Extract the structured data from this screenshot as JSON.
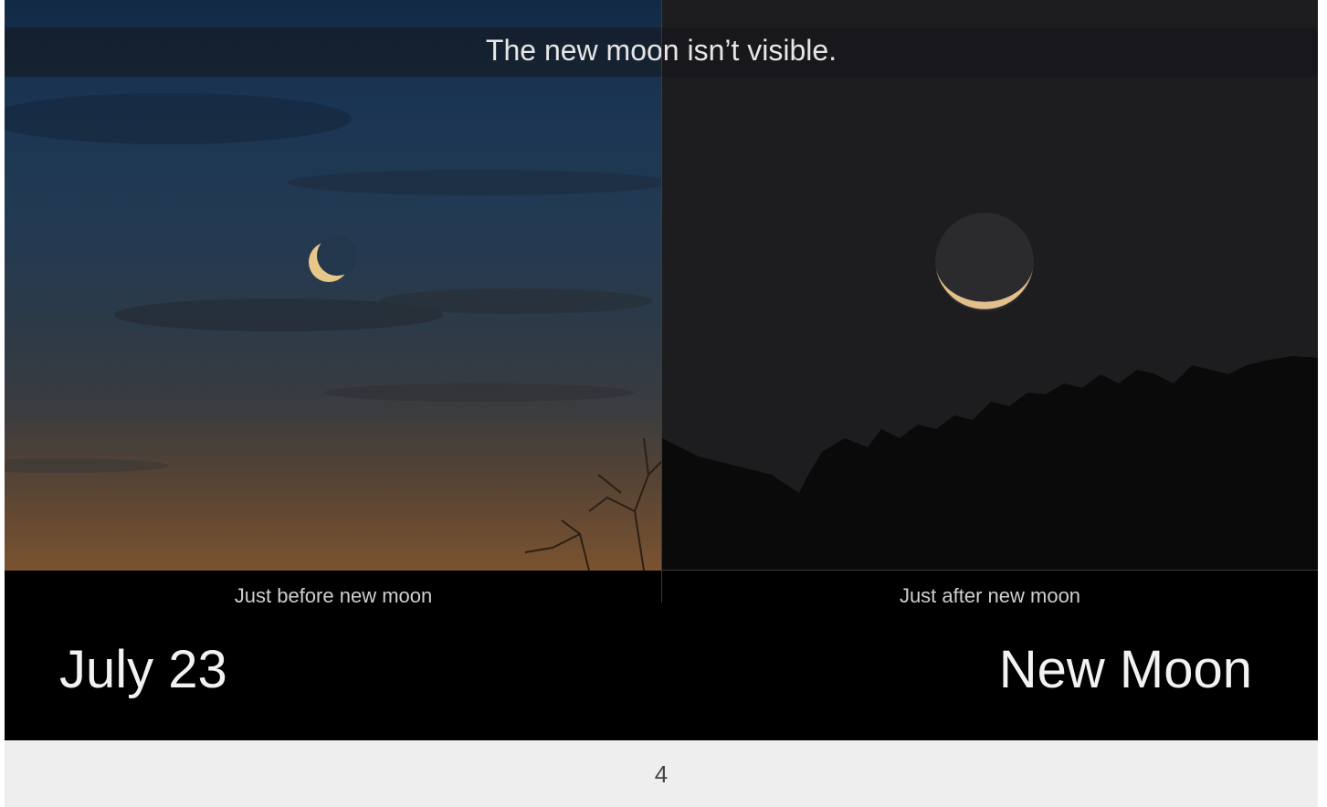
{
  "banner": {
    "text": "The new moon isn’t visible."
  },
  "panels": [
    {
      "caption": "Just before new moon"
    },
    {
      "caption": "Just after new moon"
    }
  ],
  "labels": {
    "date": "July 23",
    "phase": "New Moon"
  },
  "footer": {
    "page_number": "4"
  }
}
